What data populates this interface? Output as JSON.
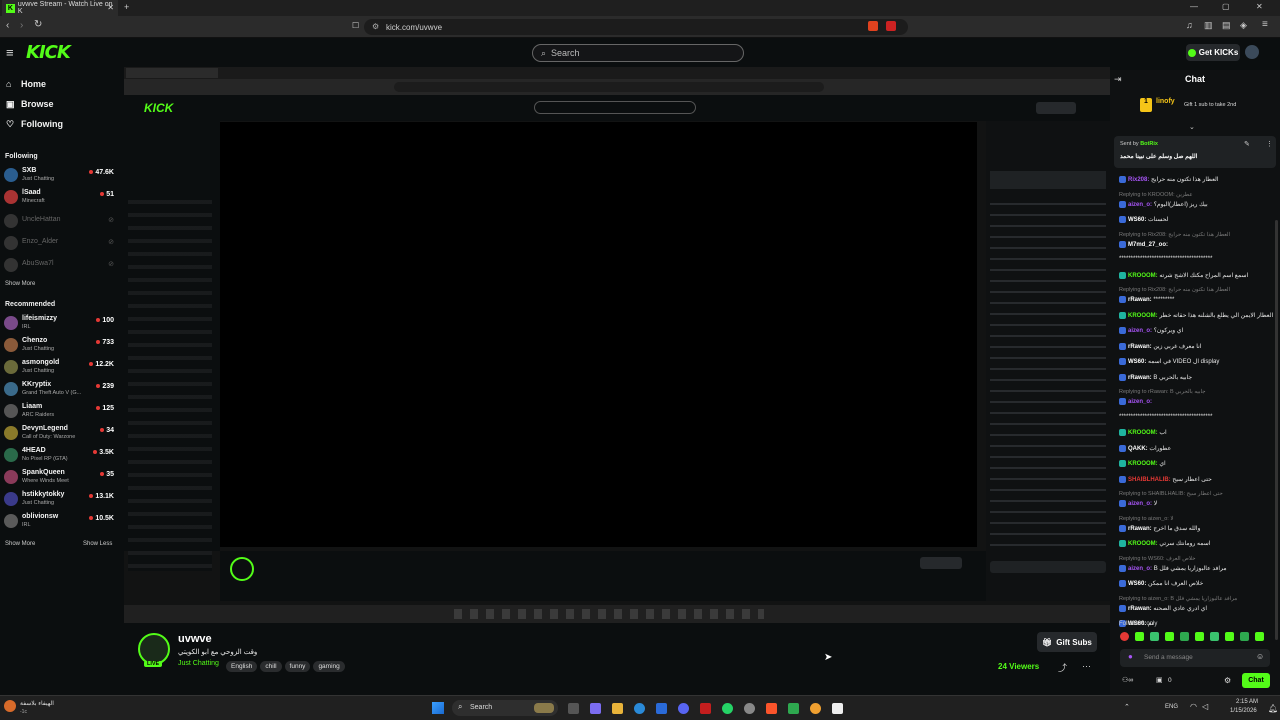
{
  "browser": {
    "tab_title": "uvwve Stream - Watch Live on K",
    "url": "kick.com/uvwve"
  },
  "header": {
    "logo": "KICK",
    "search_placeholder": "Search",
    "get_kicks": "Get KICKs"
  },
  "sidebar": {
    "nav": [
      {
        "label": "Home",
        "icon": "home-icon"
      },
      {
        "label": "Browse",
        "icon": "browse-icon"
      },
      {
        "label": "Following",
        "icon": "heart-icon"
      }
    ],
    "following_heading": "Following",
    "following": [
      {
        "name": "SXB",
        "category": "Just Chatting",
        "viewers": "47.6K",
        "color": "#2a5d8f"
      },
      {
        "name": "lSaad",
        "category": "Minecraft",
        "viewers": "51",
        "color": "#a33"
      },
      {
        "name": "UncleHattan",
        "category": "",
        "viewers": "",
        "color": "#444"
      },
      {
        "name": "Enzo_Alder",
        "category": "",
        "viewers": "",
        "color": "#444"
      },
      {
        "name": "AbuSwa7l",
        "category": "",
        "viewers": "",
        "color": "#444"
      }
    ],
    "show_more_following": "Show More",
    "recommended_heading": "Recommended",
    "recommended": [
      {
        "name": "lifeismizzy",
        "category": "IRL",
        "viewers": "100",
        "color": "#7a4a8a"
      },
      {
        "name": "Chenzo",
        "category": "Just Chatting",
        "viewers": "733",
        "color": "#8a5a3a"
      },
      {
        "name": "asmongold",
        "category": "Just Chatting",
        "viewers": "12.2K",
        "color": "#6a6a3a"
      },
      {
        "name": "KKryptix",
        "category": "Grand Theft Auto V (G...",
        "viewers": "239",
        "color": "#3a6a8a"
      },
      {
        "name": "Liaam",
        "category": "ARC Raiders",
        "viewers": "125",
        "color": "#555"
      },
      {
        "name": "DevynLegend",
        "category": "Call of Duty: Warzone",
        "viewers": "34",
        "color": "#8a7a2a"
      },
      {
        "name": "4HEAD",
        "category": "No Pixel RP (GTA)",
        "viewers": "3.5K",
        "color": "#2a6a4a"
      },
      {
        "name": "SpankQueen",
        "category": "Where Winds Meet",
        "viewers": "35",
        "color": "#8a3a5a"
      },
      {
        "name": "hstikkytokky",
        "category": "Just Chatting",
        "viewers": "13.1K",
        "color": "#3a3a8a"
      },
      {
        "name": "oblivionsw",
        "category": "IRL",
        "viewers": "10.5K",
        "color": "#5a5a5a"
      }
    ],
    "show_more": "Show More",
    "show_less": "Show Less"
  },
  "stream": {
    "channel": "uvwve",
    "title": "وقت الزوحي مع ابو الكويتي",
    "category": "Just Chatting",
    "tags": [
      "English",
      "chill",
      "funny",
      "gaming"
    ],
    "viewers": "24 Viewers",
    "gift_subs": "Gift Subs",
    "live_badge": "LIVE"
  },
  "chat": {
    "title": "Chat",
    "top_gifter": "linofy",
    "top_gifter_count": "1",
    "gift_prompt": "Gift 1 sub to take 2nd",
    "pinned_sender_prefix": "Sent by",
    "pinned_sender": "BotRix",
    "pinned_message": "اللهم صل وسلم على نبينا محمد",
    "messages": [
      {
        "reply": "",
        "user": "Rix208:",
        "color": "#a855f7",
        "text": "العطار هذا تكتون منه حرايج"
      },
      {
        "reply": "Replying to KROOOM: عطرين",
        "user": "aizen_o:",
        "color": "#a855f7",
        "text": "بيك ريز (اعطار)اليوم؟"
      },
      {
        "reply": "",
        "user": "WS60:",
        "color": "#ffffff",
        "text": "لحسنات"
      },
      {
        "reply": "Replying to Rix208: العطار هذا تكتون منه حرايج",
        "user": "M7md_27_oo:",
        "color": "#ffffff",
        "text": ""
      },
      {
        "reply": "",
        "user": "",
        "color": "#ffffff",
        "text": "****************************************"
      },
      {
        "reply": "",
        "user": "KROOOM:",
        "color": "#53fc18",
        "text": "اسمع اسم المراح مكتك الاشج شرته"
      },
      {
        "reply": "Replying to Rix208: العطار هذا تكتون منه حرايج",
        "user": "rRawan:",
        "color": "#ffffff",
        "text": "*********"
      },
      {
        "reply": "",
        "user": "KROOOM:",
        "color": "#53fc18",
        "text": "العطار الايمن الي يطلع بالشلنه هذا حقاته خطر"
      },
      {
        "reply": "",
        "user": "aizen_o:",
        "color": "#a855f7",
        "text": "اي ويركون؟"
      },
      {
        "reply": "",
        "user": "rRawan:",
        "color": "#ffffff",
        "text": "انا معرف غربي زين"
      },
      {
        "reply": "",
        "user": "WS60:",
        "color": "#ffffff",
        "text": "في اسمه VIDEO ال display"
      },
      {
        "reply": "",
        "user": "rRawan:",
        "color": "#ffffff",
        "text": "B جابيه بالحربي"
      },
      {
        "reply": "Replying to rRawan: B جابيه بالحربي",
        "user": "aizen_o:",
        "color": "#a855f7",
        "text": ""
      },
      {
        "reply": "",
        "user": "",
        "color": "#ffffff",
        "text": "****************************************"
      },
      {
        "reply": "",
        "user": "KROOOM:",
        "color": "#53fc18",
        "text": "اب"
      },
      {
        "reply": "",
        "user": "QAKK:",
        "color": "#ffffff",
        "text": "عطورات"
      },
      {
        "reply": "",
        "user": "KROOOM:",
        "color": "#53fc18",
        "text": "اي"
      },
      {
        "reply": "",
        "user": "SHAIBLHALIB:",
        "color": "#e53935",
        "text": "حتى اعطار سيح"
      },
      {
        "reply": "Replying to SHAIBLHALIB: حتى اعطار سيح",
        "user": "aizen_o:",
        "color": "#a855f7",
        "text": "لا"
      },
      {
        "reply": "Replying to aizen_o: لا",
        "user": "rRawan:",
        "color": "#ffffff",
        "text": "والله سدق ما اخرج"
      },
      {
        "reply": "",
        "user": "KROOOM:",
        "color": "#53fc18",
        "text": "اسمه رومانتك سرتي"
      },
      {
        "reply": "Replying to WS60: خلاص العرف",
        "user": "aizen_o:",
        "color": "#a855f7",
        "text": "B مرافد عالبوزاريا يمشي فلل"
      },
      {
        "reply": "",
        "user": "WS60:",
        "color": "#ffffff",
        "text": "خلاص العرف انا ممكن"
      },
      {
        "reply": "Replying to aizen_o: B مرافد عالبوزاريا يمشي فلل",
        "user": "rRawan:",
        "color": "#ffffff",
        "text": "اي ادري عادي الصحنه"
      },
      {
        "reply": "",
        "user": "WS60:",
        "color": "#ffffff",
        "text": "تم"
      }
    ],
    "followers_only": "Followers only",
    "input_placeholder": "Send a message",
    "points": "0",
    "chat_button": "Chat"
  },
  "taskbar": {
    "weather_temp": "الهيفاء بلاسفة",
    "weather_sub": "-1c",
    "search": "Search",
    "lang": "ENG",
    "time": "2:15 AM",
    "date": "1/15/2026"
  }
}
